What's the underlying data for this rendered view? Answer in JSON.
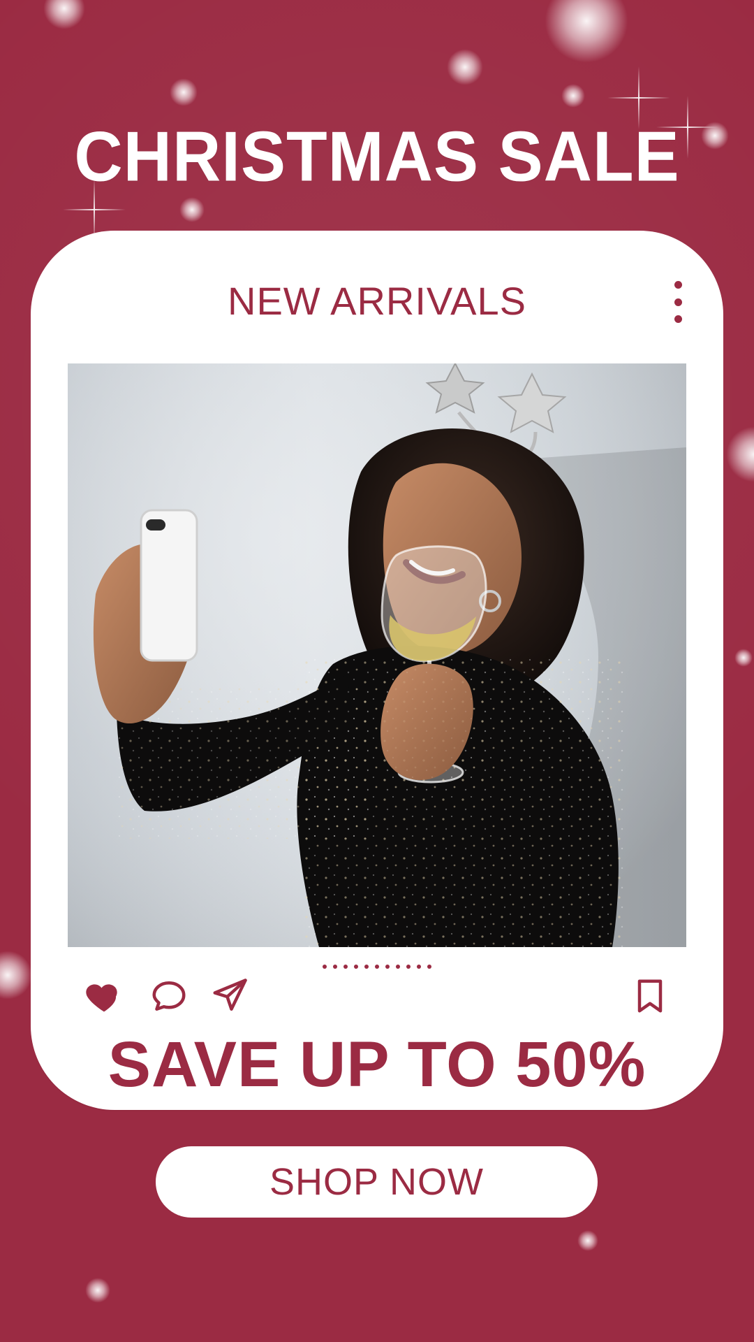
{
  "headline": "CHRISTMAS SALE",
  "card": {
    "title": "NEW ARRIVALS",
    "promo": "SAVE UP TO 50%"
  },
  "cta": {
    "label": "SHOP NOW"
  },
  "carousel": {
    "dot_count": 11
  },
  "icons": {
    "menu": "kebab-menu-icon",
    "like": "heart-icon",
    "comment": "comment-bubble-icon",
    "share": "paper-plane-icon",
    "save": "bookmark-icon"
  },
  "colors": {
    "accent": "#9b2b43",
    "card": "#ffffff"
  }
}
